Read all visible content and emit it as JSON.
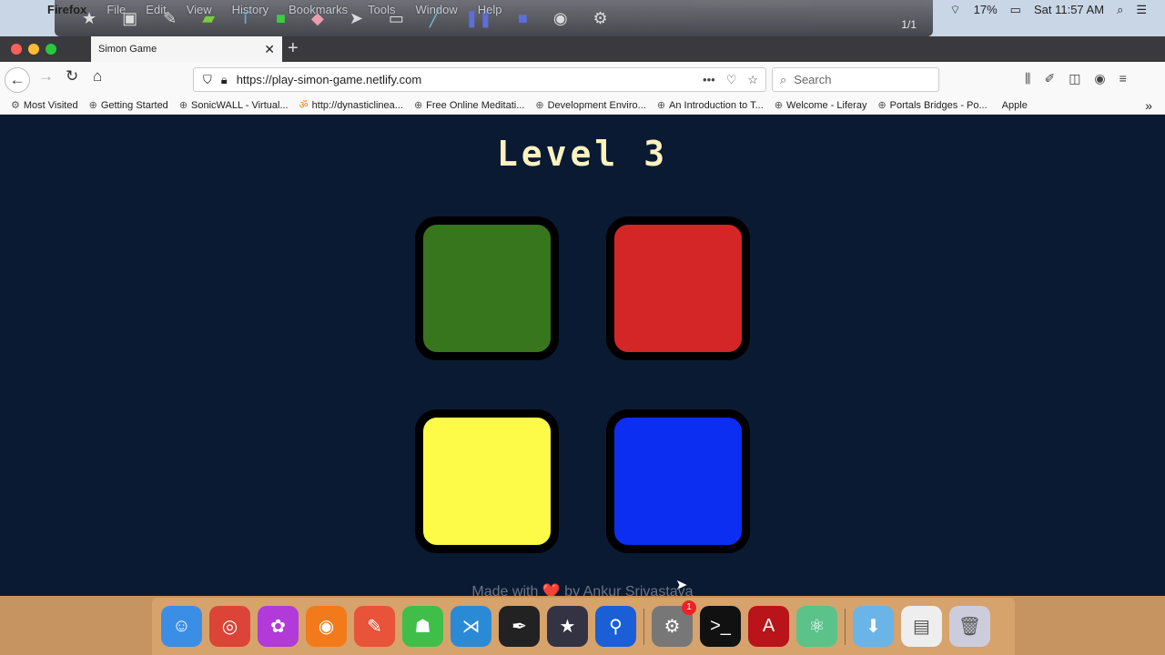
{
  "menubar": {
    "items": [
      "Firefox",
      "File",
      "Edit",
      "View",
      "History",
      "Bookmarks",
      "Tools",
      "Window",
      "Help"
    ],
    "battery": "17%",
    "clock": "Sat 11:57 AM",
    "overlay_count": "1/1"
  },
  "browser": {
    "tab_title": "Simon Game",
    "url": "https://play-simon-game.netlify.com",
    "search_placeholder": "Search",
    "bookmarks": [
      "Most Visited",
      "Getting Started",
      "SonicWALL - Virtual...",
      "http://dynasticlinea...",
      "Free Online Meditati...",
      "Development Enviro...",
      "An Introduction to T...",
      "Welcome - Liferay",
      "Portals Bridges - Po...",
      "Apple"
    ]
  },
  "game": {
    "title": "Level 3",
    "buttons": [
      {
        "id": "green",
        "color": "#38761d"
      },
      {
        "id": "red",
        "color": "#d42626"
      },
      {
        "id": "yellow",
        "color": "#fdfb48"
      },
      {
        "id": "blue",
        "color": "#0c2ef0"
      }
    ],
    "footer_prefix": "Made with",
    "footer_heart": "❤️",
    "footer_suffix": "by  Ankur Srivastava",
    "background": "#0a1a33"
  },
  "dock": {
    "apps": [
      "finder",
      "chrome",
      "flower",
      "firefox",
      "postman",
      "tortoise",
      "vscode",
      "quill",
      "starred",
      "sourcetree",
      "system-preferences",
      "terminal",
      "acrobat",
      "atom",
      "downloads",
      "preview",
      "trash"
    ],
    "notification_badge": "1"
  }
}
